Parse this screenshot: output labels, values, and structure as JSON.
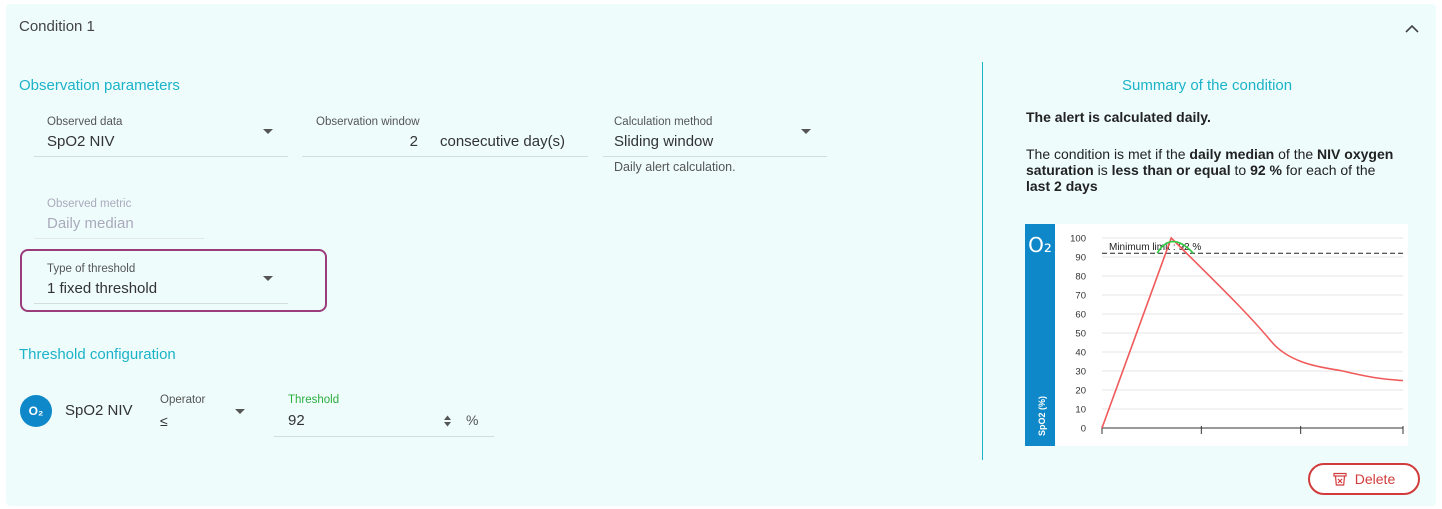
{
  "condition": {
    "title": "Condition 1"
  },
  "observation": {
    "section_title": "Observation parameters",
    "observed_data": {
      "label": "Observed data",
      "value": "SpO2 NIV"
    },
    "window": {
      "label": "Observation window",
      "value": "2",
      "unit": "consecutive day(s)"
    },
    "calc_method": {
      "label": "Calculation method",
      "value": "Sliding window",
      "helper": "Daily alert calculation."
    },
    "metric": {
      "label": "Observed metric",
      "value": "Daily median"
    },
    "threshold_type": {
      "label": "Type of threshold",
      "value": "1 fixed threshold"
    }
  },
  "threshold_config": {
    "section_title": "Threshold configuration",
    "icon_text": "O₂",
    "param_name": "SpO2 NIV",
    "operator": {
      "label": "Operator",
      "value": "≤"
    },
    "threshold": {
      "label": "Threshold",
      "value": "92",
      "unit": "%"
    }
  },
  "summary": {
    "title": "Summary of the condition",
    "frequency": "The alert is calculated daily.",
    "sentence": {
      "p1": "The condition is met if the ",
      "b1": "daily median",
      "p2": " of the ",
      "b2": "NIV oxygen saturation",
      "p3": " is ",
      "b3": "less than or equal",
      "p4": " to ",
      "b4": "92 %",
      "p5": " for each of the ",
      "b5": "last 2 days"
    }
  },
  "chart_data": {
    "type": "line",
    "ylabel": "SpO2 (%)",
    "side_icon": "O₂",
    "ylim": [
      0,
      100
    ],
    "yticks": [
      0,
      10,
      20,
      30,
      40,
      50,
      60,
      70,
      80,
      90,
      100
    ],
    "limit": {
      "label": "Minimum limit : 92 %",
      "value": 92
    },
    "series": [
      {
        "color": "#f05a5a",
        "points": [
          [
            0,
            0
          ],
          [
            2.3,
            100
          ],
          [
            5.6,
            46
          ],
          [
            8,
            30
          ],
          [
            10,
            25
          ]
        ]
      }
    ],
    "above_limit_color": "#2ecc40",
    "grid": true
  },
  "delete": {
    "label": "Delete"
  },
  "colors": {
    "accent": "#1cb3c8",
    "highlight": "#9a3d7a",
    "danger": "#d23b3b",
    "brand_blue": "#0e88c9"
  }
}
